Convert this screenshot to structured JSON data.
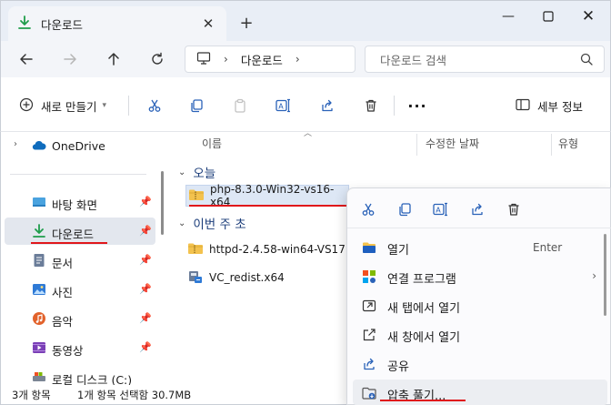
{
  "window": {
    "tab_title": "다운로드",
    "new_tab": "+",
    "minimize": "—",
    "close": "✕"
  },
  "nav": {
    "breadcrumb": "다운로드",
    "search_placeholder": "다운로드 검색"
  },
  "command_bar": {
    "new_label": "새로 만들기",
    "details_label": "세부 정보",
    "more": "···"
  },
  "sidebar": {
    "items": [
      {
        "label": "OneDrive",
        "icon": "cloud-icon"
      },
      {
        "label": "바탕 화면",
        "icon": "desktop-icon"
      },
      {
        "label": "다운로드",
        "icon": "download-icon"
      },
      {
        "label": "문서",
        "icon": "document-icon"
      },
      {
        "label": "사진",
        "icon": "pictures-icon"
      },
      {
        "label": "음악",
        "icon": "music-icon"
      },
      {
        "label": "동영상",
        "icon": "video-icon"
      },
      {
        "label": "로컬 디스크 (C:)",
        "icon": "drive-icon"
      }
    ],
    "pin_glyph": "📌"
  },
  "columns": {
    "name": "이름",
    "modified": "수정한 날짜",
    "type": "유형"
  },
  "groups": {
    "today": "오늘",
    "last_week": "이번 주 초"
  },
  "files": {
    "today": [
      {
        "name": "php-8.3.0-Win32-vs16-x64",
        "icon": "zip-folder-icon"
      }
    ],
    "last_week": [
      {
        "name": "httpd-2.4.58-win64-VS17",
        "icon": "zip-folder-icon"
      },
      {
        "name": "VC_redist.x64",
        "icon": "installer-icon"
      }
    ]
  },
  "status": {
    "count": "3개 항목",
    "selection": "1개 항목 선택함 30.7MB"
  },
  "context_menu": {
    "items": [
      {
        "label": "열기",
        "shortcut": "Enter",
        "icon": "open-icon"
      },
      {
        "label": "연결 프로그램",
        "submenu": true,
        "icon": "open-with-icon"
      },
      {
        "label": "새 탭에서 열기",
        "icon": "new-tab-icon"
      },
      {
        "label": "새 창에서 열기",
        "icon": "new-window-icon"
      },
      {
        "label": "공유",
        "icon": "share-icon"
      },
      {
        "label": "압축 풀기...",
        "icon": "extract-icon"
      }
    ],
    "submenu_arrow": "›"
  },
  "colors": {
    "accent_red": "#e0171b",
    "selection_blue": "#dde7f5",
    "download_green": "#1f9d4b",
    "group_blue": "#1b3d7a"
  }
}
